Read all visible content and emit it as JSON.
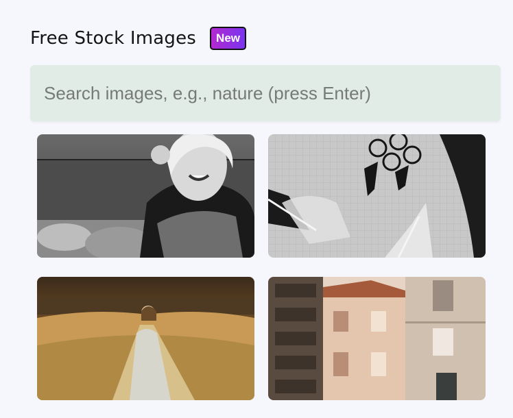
{
  "header": {
    "title": "Free Stock Images",
    "badge": "New"
  },
  "search": {
    "placeholder": "Search images, e.g., nature (press Enter)",
    "value": ""
  },
  "images": [
    {
      "subject": "woman-smiling-scarf-bw"
    },
    {
      "subject": "bicycle-shadows-pavement-bw"
    },
    {
      "subject": "woman-coat-field-path"
    },
    {
      "subject": "old-town-buildings"
    }
  ],
  "colors": {
    "background": "#f6f7fc",
    "search_bg": "#e0ece5",
    "badge_gradient_start": "#b22ad0",
    "badge_gradient_end": "#7a34f0"
  }
}
